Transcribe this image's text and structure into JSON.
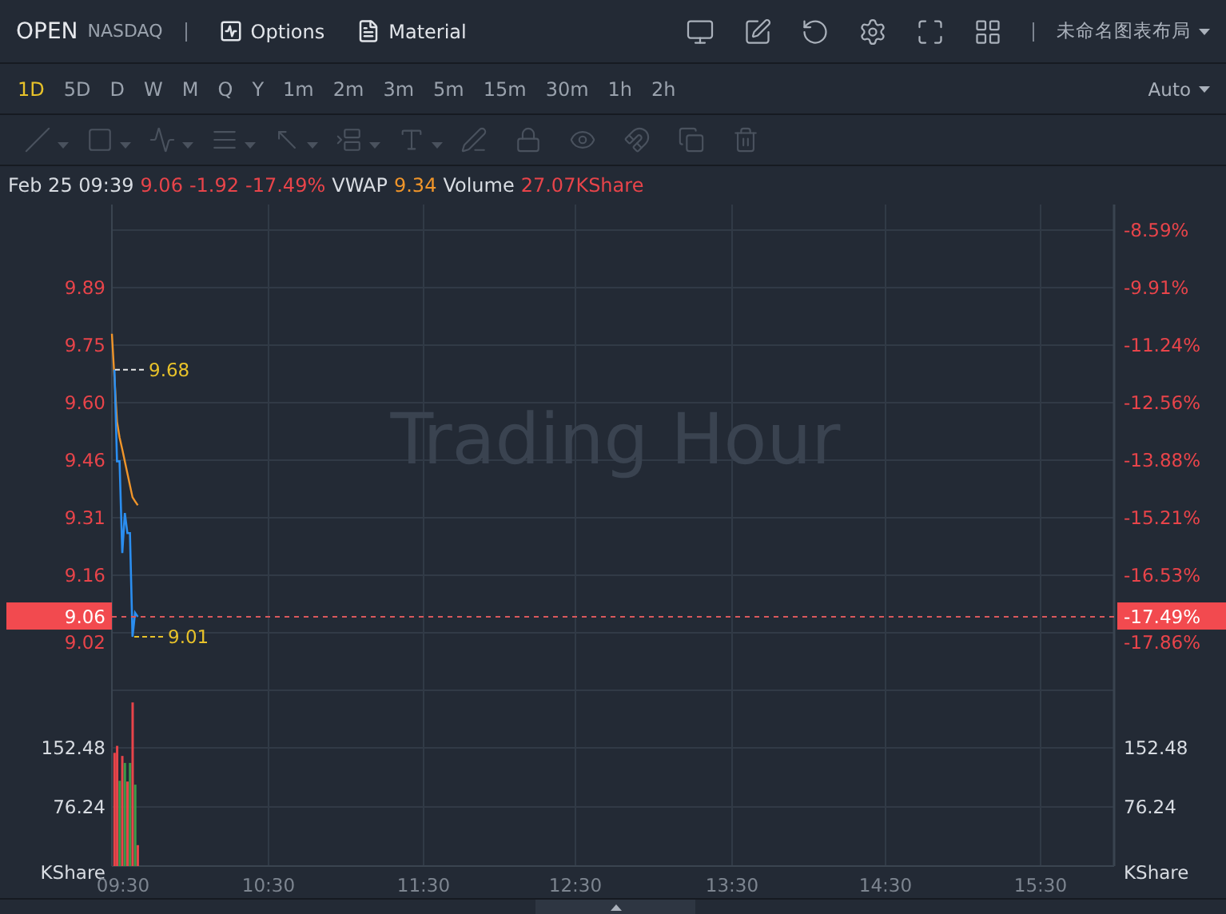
{
  "header": {
    "symbol": "OPEN",
    "exchange": "NASDAQ",
    "links": [
      "Options",
      "Material"
    ],
    "layout_name": "未命名图表布局"
  },
  "periods": [
    {
      "label": "1D",
      "selected": true
    },
    {
      "label": "5D",
      "selected": false
    },
    {
      "label": "D",
      "selected": false
    },
    {
      "label": "W",
      "selected": false
    },
    {
      "label": "M",
      "selected": false
    },
    {
      "label": "Q",
      "selected": false
    },
    {
      "label": "Y",
      "selected": false
    },
    {
      "label": "1m",
      "selected": false
    },
    {
      "label": "2m",
      "selected": false
    },
    {
      "label": "3m",
      "selected": false
    },
    {
      "label": "5m",
      "selected": false
    },
    {
      "label": "15m",
      "selected": false
    },
    {
      "label": "30m",
      "selected": false
    },
    {
      "label": "1h",
      "selected": false
    },
    {
      "label": "2h",
      "selected": false
    }
  ],
  "scale_mode": "Auto",
  "info_line": {
    "time": "Feb 25 09:39",
    "price": "9.06",
    "change": "-1.92",
    "change_percent": "-17.49%",
    "vwap_label": "VWAP",
    "vwap": "9.34",
    "volume_label": "Volume",
    "volume": "27.07KShare"
  },
  "price_panel": {
    "watermark": "Trading Hour",
    "price_labels": [
      "9.89",
      "9.75",
      "9.60",
      "9.46",
      "9.31",
      "9.16",
      "9.02"
    ],
    "percent_labels": [
      "-8.59%",
      "-9.91%",
      "-11.24%",
      "-12.56%",
      "-13.88%",
      "-15.21%",
      "-16.53%",
      "-17.86%"
    ],
    "high_marker": "9.68",
    "low_marker": "9.01",
    "current_price": "9.06",
    "current_percent": "-17.49%"
  },
  "volume_panel": {
    "left_labels": [
      "152.48",
      "76.24",
      "KShare"
    ],
    "right_labels": [
      "152.48",
      "76.24",
      "KShare"
    ]
  },
  "time_labels": [
    "09:30",
    "10:30",
    "11:30",
    "12:30",
    "13:30",
    "14:30",
    "15:30"
  ]
}
